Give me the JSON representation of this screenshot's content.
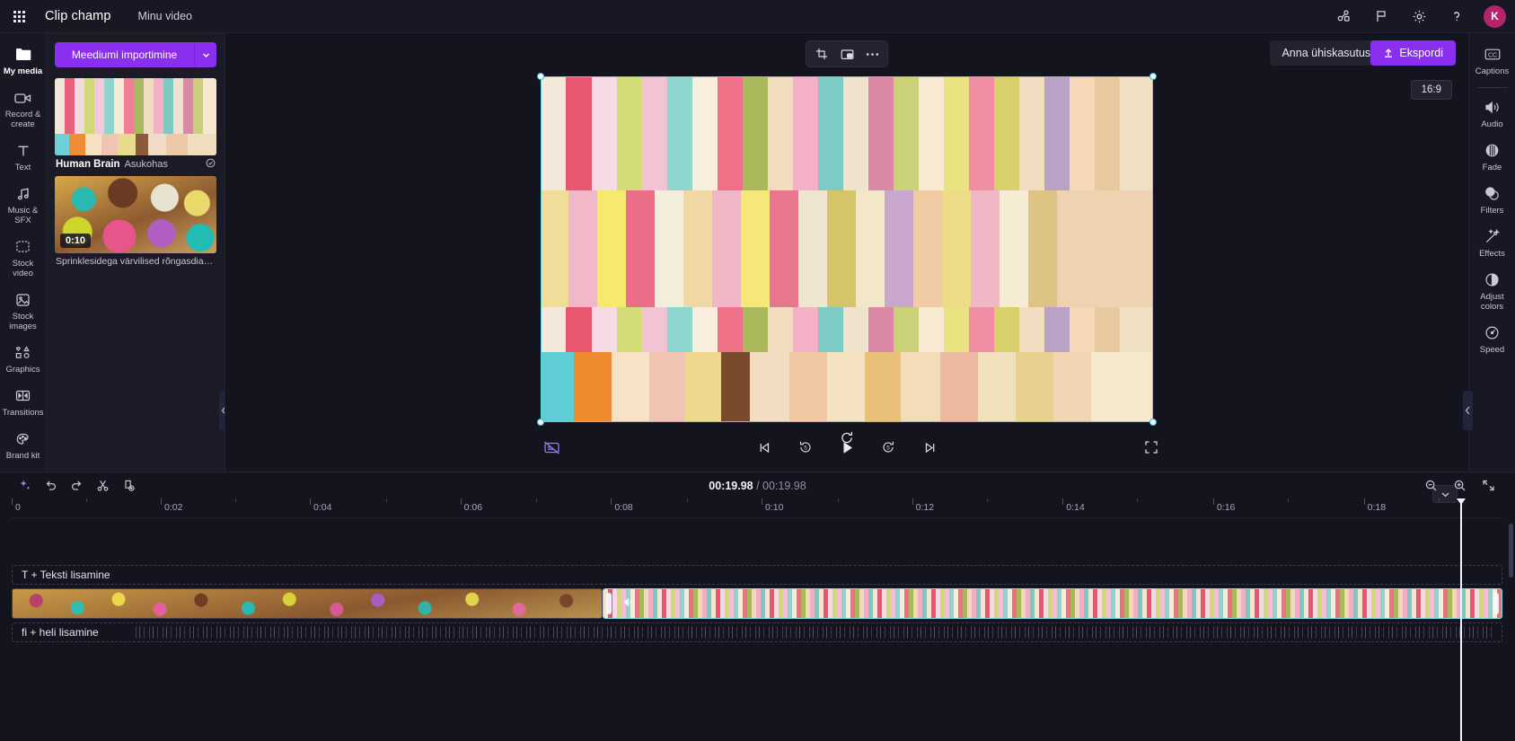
{
  "app": {
    "brand": "Clip champ",
    "project_name": "Minu video",
    "avatar_initial": "K",
    "accent_color": "#8a2ef0",
    "selection_color": "#5ad0e0"
  },
  "topbar": {
    "icons": [
      {
        "name": "share-branch-icon",
        "label": "Share"
      },
      {
        "name": "flag-icon",
        "label": "Feedback"
      },
      {
        "name": "gear-icon",
        "label": "Settings"
      },
      {
        "name": "help-icon",
        "label": "Help"
      }
    ]
  },
  "left_rail": {
    "items": [
      {
        "label": "My media",
        "icon": "folder-icon",
        "active": true
      },
      {
        "label": "Record & create",
        "icon": "video-camera-icon",
        "active": false
      },
      {
        "label": "Text",
        "icon": "text-icon",
        "active": false
      },
      {
        "label": "Music & SFX",
        "icon": "music-note-icon",
        "active": false
      },
      {
        "label": "Stock video",
        "icon": "film-strip-icon",
        "active": false
      },
      {
        "label": "Stock images",
        "icon": "image-icon",
        "active": false
      },
      {
        "label": "Graphics",
        "icon": "shapes-icon",
        "active": false
      },
      {
        "label": "Transitions",
        "icon": "transitions-icon",
        "active": false
      },
      {
        "label": "Brand kit",
        "icon": "brand-kit-icon",
        "active": false
      }
    ]
  },
  "media_panel": {
    "import_button": "Meediumi importimine",
    "items": [
      {
        "title_bold": "Human Brain",
        "title_dim": "Asukohas",
        "duration": "",
        "thumb": "macaron"
      },
      {
        "caption": "Sprinklesidega värvilised rõngasdiagrammid @",
        "duration": "0:10",
        "thumb": "donut"
      }
    ]
  },
  "preview": {
    "float_tools": [
      {
        "name": "crop-icon",
        "label": "Crop"
      },
      {
        "name": "picture-in-picture-icon",
        "label": "Picture in picture"
      },
      {
        "name": "more-options-icon",
        "label": "More"
      }
    ],
    "share_label": "Anna ühiskasutusse",
    "export_label": "Ekspordi",
    "aspect_ratio": "16:9",
    "playback": {
      "skip_back_label": "Skip to start",
      "back_5_label": "5",
      "play_label": "Play",
      "fwd_5_label": "5",
      "skip_fwd_label": "Skip to end",
      "fullscreen_label": "Fullscreen",
      "captions_label": "Captions off"
    }
  },
  "timeline": {
    "toolbar": [
      {
        "name": "ai-sparkle-icon",
        "label": "AI tools"
      },
      {
        "name": "undo-icon",
        "label": "Undo"
      },
      {
        "name": "redo-icon",
        "label": "Redo"
      },
      {
        "name": "split-scissors-icon",
        "label": "Split"
      },
      {
        "name": "duplicate-icon",
        "label": "Duplicate"
      }
    ],
    "current_time": "00:19.98",
    "separator": " / ",
    "total_time": "00:19.98",
    "zoom_controls": [
      {
        "name": "zoom-out-icon",
        "label": "Zoom out"
      },
      {
        "name": "zoom-in-icon",
        "label": "Zoom in"
      },
      {
        "name": "fit-timeline-icon",
        "label": "Fit to timeline"
      }
    ],
    "ruler_ticks": [
      {
        "label": "0",
        "pos_pct": 0
      },
      {
        "label": "0:02",
        "pos_pct": 10
      },
      {
        "label": "0:04",
        "pos_pct": 20
      },
      {
        "label": "0:06",
        "pos_pct": 30.1
      },
      {
        "label": "0:08",
        "pos_pct": 40.2
      },
      {
        "label": "0:10",
        "pos_pct": 50.3
      },
      {
        "label": "0:12",
        "pos_pct": 60.4
      },
      {
        "label": "0:14",
        "pos_pct": 70.5
      },
      {
        "label": "0:16",
        "pos_pct": 80.6
      },
      {
        "label": "0:18",
        "pos_pct": 90.7
      }
    ],
    "text_track_label": "T + Teksti lisamine",
    "audio_track_label": "fi + heli lisamine",
    "clips": [
      {
        "name": "donut-video-clip",
        "selected": false
      },
      {
        "name": "macaron-video-clip",
        "selected": true
      }
    ]
  },
  "right_rail": {
    "items": [
      {
        "label": "Captions",
        "icon": "closed-captions-icon"
      },
      {
        "label": "Audio",
        "icon": "speaker-icon"
      },
      {
        "label": "Fade",
        "icon": "fade-icon"
      },
      {
        "label": "Filters",
        "icon": "filters-icon"
      },
      {
        "label": "Effects",
        "icon": "magic-wand-icon"
      },
      {
        "label": "Adjust colors",
        "icon": "contrast-circle-icon"
      },
      {
        "label": "Speed",
        "icon": "speedometer-icon"
      }
    ]
  }
}
